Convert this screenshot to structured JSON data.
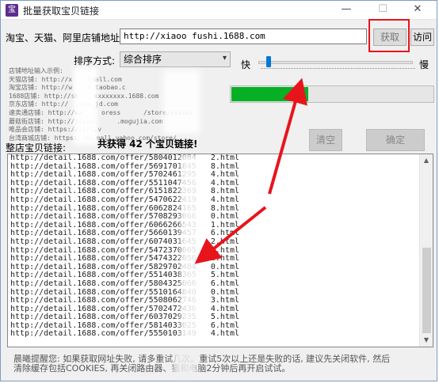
{
  "window": {
    "title": "批量获取宝贝链接",
    "icon_glyph": "宝",
    "minimize_glyph": "—",
    "maximize_glyph": "☐",
    "close_glyph": "✕"
  },
  "toolbar": {
    "url_label": "淘宝、天猫、阿里店铺地址:",
    "url_value": "http://xiaoo  fushi.1688.com",
    "fetch_label": "获取",
    "visit_label": "访问"
  },
  "sort": {
    "label": "排序方式:",
    "selected": "综合排序",
    "arrow_glyph": "▾"
  },
  "speed": {
    "fast_label": "快",
    "slow_label": "慢",
    "level": 0.05
  },
  "examples": {
    "lines": [
      "店铺地址输入示例:",
      "天猫店铺: http://x    tmall.com",
      "淘宝店铺: http://w    6.taobao.c",
      "1688店铺: http://sh    xxxxxxxx.1688.com",
      "京东店铺: http://   xxx.jd.com",
      "速卖通店铺: http://ww     oress      /store/xxxxxx",
      "蘑菇街店铺: http://jiyou      .mogujia.com",
      "唯品会店铺: https://list.v",
      "台湾商城店铺: https://tw.mall.yahoo.com/store/"
    ]
  },
  "progress": {
    "value": 0.38,
    "color": "#06b025"
  },
  "actions": {
    "clear_label": "清空",
    "confirm_label": "确定"
  },
  "links": {
    "label": "整店宝贝链接:",
    "count_text": "共获得 42 个宝贝链接!",
    "items": [
      "http://detail.1688.com/offer/5804012084   2.html",
      "http://detail.1688.com/offer/5691701845   8.html",
      "http://detail.1688.com/offer/5702461295   4.html",
      "http://detail.1688.com/offer/5511047456   4.html",
      "http://detail.1688.com/offer/6151822369   8.html",
      "http://detail.1688.com/offer/5470622419   4.html",
      "http://detail.1688.com/offer/6062824165   8.html",
      "http://detail.1688.com/offer/5708293066   0.html",
      "http://detail.1688.com/offer/6066266543   1.html",
      "http://detail.1688.com/offer/5660139457   6.html",
      "http://detail.1688.com/offer/6074031645   2.html",
      "http://detail.1688.com/offer/5472370065   3.html",
      "http://detail.1688.com/offer/5474322056   6.html",
      "http://detail.1688.com/offer/5829702484   0.html",
      "http://detail.1688.com/offer/5514038365   5.html",
      "http://detail.1688.com/offer/5804325066   6.html",
      "http://detail.1688.com/offer/5510164840   0.html",
      "http://detail.1688.com/offer/5508062746   3.html",
      "http://detail.1688.com/offer/5702472436   4.html",
      "http://detail.1688.com/offer/6037029235   5.html",
      "http://detail.1688.com/offer/5814033025   6.html",
      "http://detail.1688.com/offer/5550103149   4.html"
    ]
  },
  "scroll": {
    "up_glyph": "▲",
    "down_glyph": "▼"
  },
  "tip": {
    "line1": "晨曦提醒您: 如果获取网址失败, 请多重试几次。重试5次以上还是失败的话, 建议先关闭软件, 然后",
    "line2": "清除缓存包括COOKIES, 再关闭路由器、猫和电脑2分钟后再开启试试。"
  },
  "colors": {
    "highlight": "#e8141c",
    "arrow": "#e8141c",
    "progress": "#06b025"
  }
}
